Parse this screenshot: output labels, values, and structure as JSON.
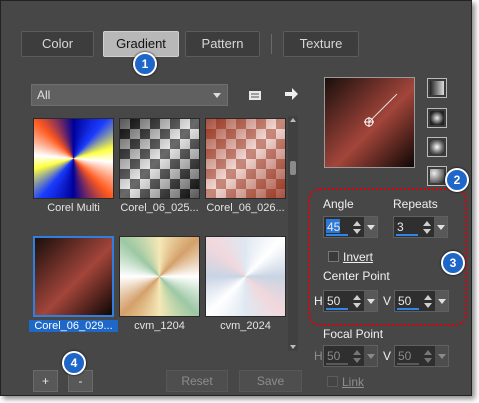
{
  "tabs": [
    {
      "label": "Color"
    },
    {
      "label": "Gradient"
    },
    {
      "label": "Pattern"
    },
    {
      "label": "Texture"
    }
  ],
  "badges": [
    "1",
    "2",
    "3",
    "4"
  ],
  "category_dropdown": {
    "value": "All"
  },
  "swatches": [
    {
      "label": "Corel Multi"
    },
    {
      "label": "Corel_06_025..."
    },
    {
      "label": "Corel_06_026..."
    },
    {
      "label": "Corel_06_029..."
    },
    {
      "label": "cvm_1204"
    },
    {
      "label": "cvm_2024"
    }
  ],
  "buttons": {
    "add": "+",
    "remove": "-",
    "reset": "Reset",
    "save": "Save"
  },
  "settings": {
    "angle_label": "Angle",
    "angle_value": "45",
    "repeats_label": "Repeats",
    "repeats_value": "3",
    "invert_label": "Invert",
    "center_label": "Center Point",
    "center_h_label": "H",
    "center_h_value": "50",
    "center_v_label": "V",
    "center_v_value": "50",
    "focal_label": "Focal Point",
    "focal_h_label": "H",
    "focal_h_value": "50",
    "focal_v_label": "V",
    "focal_v_value": "50",
    "link_label": "Link"
  },
  "colors": {
    "accent": "#1f66c9",
    "highlight_border": "#e0000b",
    "panel_bg": "#474747"
  },
  "icons": [
    "browse-icon",
    "arrow-right-icon",
    "gradient-style-linear-icon",
    "gradient-style-rectangular-icon",
    "gradient-style-sunburst-icon",
    "gradient-style-radial-icon"
  ]
}
